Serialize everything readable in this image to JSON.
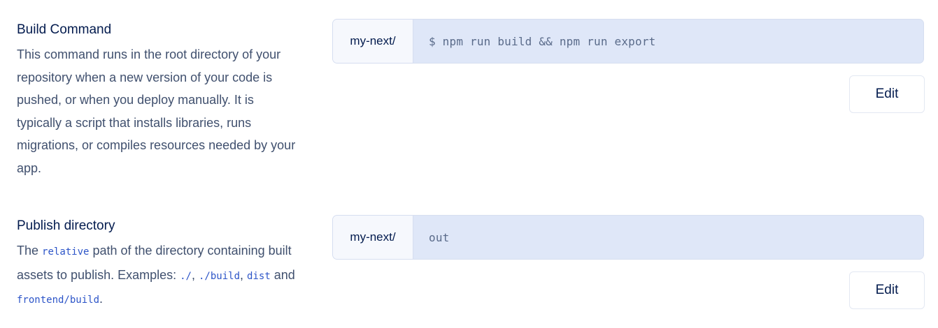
{
  "build": {
    "title": "Build Command",
    "description": "This command runs in the root directory of your repository when a new version of your code is pushed, or when you deploy manually. It is typically a script that installs libraries, runs migrations, or compiles resources needed by your app.",
    "prefix": "my-next/",
    "value": "$ npm run build && npm run export",
    "edit_label": "Edit"
  },
  "publish": {
    "title": "Publish directory",
    "desc_the": "The ",
    "desc_code_relative": "relative",
    "desc_part2": " path of the directory containing built assets to publish. Examples: ",
    "ex1": "./",
    "sep1": ", ",
    "ex2": "./build",
    "sep2": ", ",
    "ex3": "dist",
    "and": " and ",
    "ex4": "frontend/build",
    "period": ".",
    "prefix": "my-next/",
    "value": "out",
    "edit_label": "Edit"
  }
}
